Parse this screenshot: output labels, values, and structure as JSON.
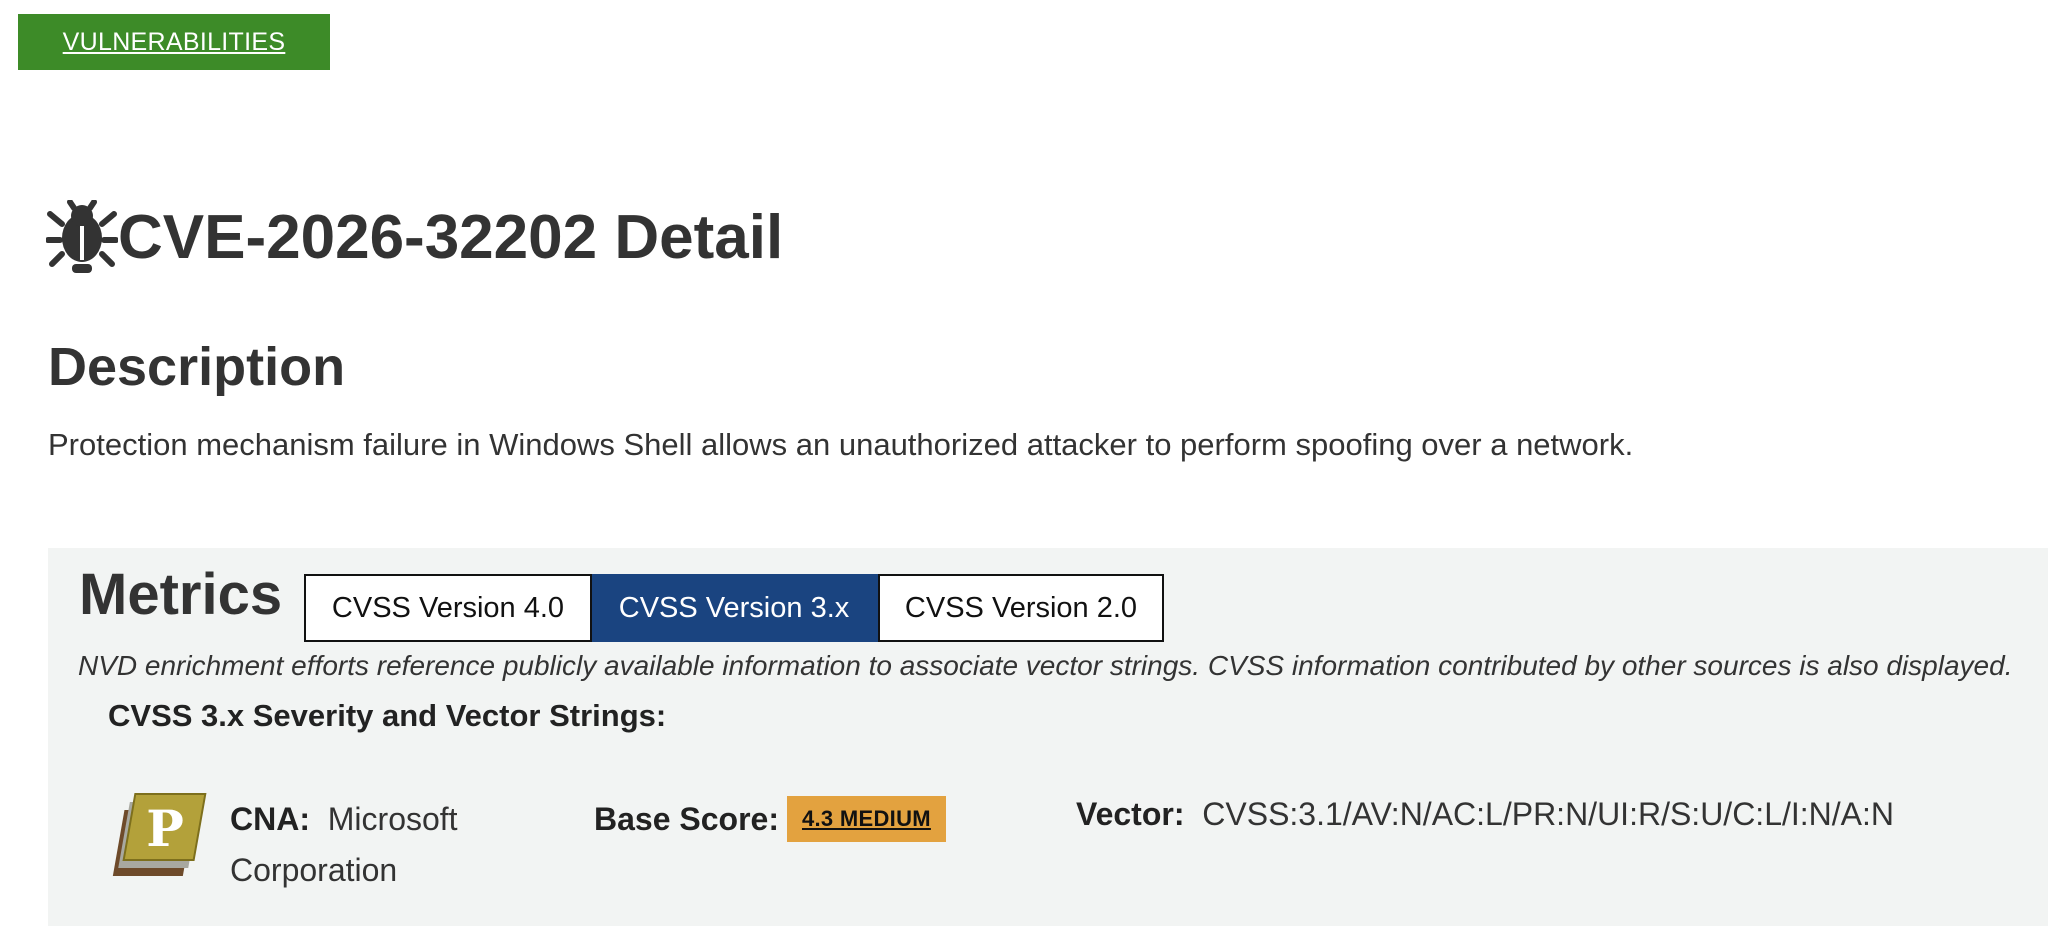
{
  "banner": {
    "label": "VULNERABILITIES",
    "color": "#3d8b28"
  },
  "page": {
    "title": "CVE-2026-32202 Detail",
    "title_icon": "bug-icon"
  },
  "description": {
    "heading": "Description",
    "text": "Protection mechanism failure in Windows Shell allows an unauthorized attacker to perform spoofing over a network."
  },
  "metrics": {
    "heading": "Metrics",
    "tabs": [
      {
        "label": "CVSS Version 4.0",
        "active": false
      },
      {
        "label": "CVSS Version 3.x",
        "active": true
      },
      {
        "label": "CVSS Version 2.0",
        "active": false
      }
    ],
    "note": "NVD enrichment efforts reference publicly available information to associate vector strings. CVSS information contributed by other sources is also displayed.",
    "subheading": "CVSS 3.x Severity and Vector Strings:",
    "cna": {
      "icon": "cna-provider-icon",
      "label": "CNA:",
      "value": "Microsoft Corporation"
    },
    "base_score": {
      "label": "Base Score:",
      "value": "4.3 MEDIUM",
      "color": "#e3a23f"
    },
    "vector": {
      "label": "Vector:",
      "value": "CVSS:3.1/AV:N/AC:L/PR:N/UI:R/S:U/C:L/I:N/A:N"
    },
    "active_tab_color": "#1a4480"
  }
}
